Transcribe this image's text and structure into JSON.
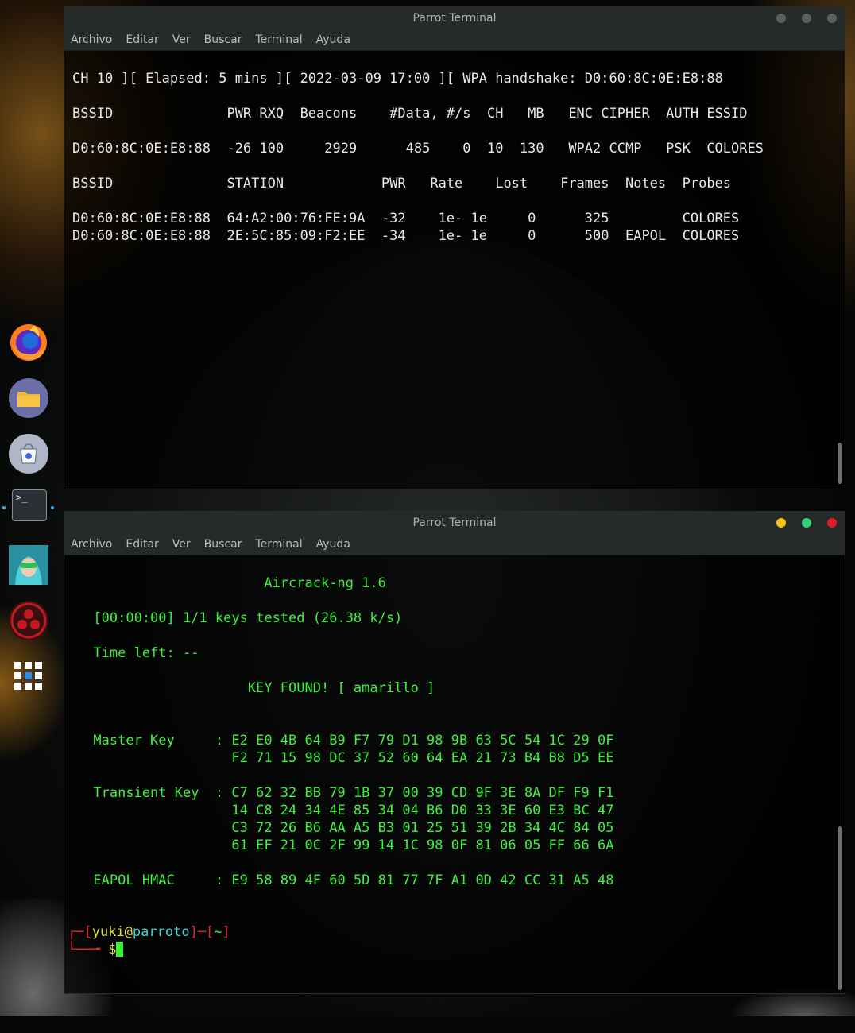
{
  "dock": {
    "items": [
      {
        "name": "firefox",
        "icon": "firefox-icon"
      },
      {
        "name": "files",
        "icon": "folder-icon"
      },
      {
        "name": "software-store",
        "icon": "store-icon"
      },
      {
        "name": "terminal",
        "icon": "terminal-icon"
      },
      {
        "name": "avatar",
        "icon": "avatar-icon"
      },
      {
        "name": "parrot",
        "icon": "parrot-icon"
      },
      {
        "name": "app-grid",
        "icon": "grid-icon"
      }
    ],
    "terminal_glyph": ">_"
  },
  "menu": [
    "Archivo",
    "Editar",
    "Ver",
    "Buscar",
    "Terminal",
    "Ayuda"
  ],
  "window_top": {
    "title": "Parrot Terminal",
    "lines": [
      "",
      "CH 10 ][ Elapsed: 5 mins ][ 2022-03-09 17:00 ][ WPA handshake: D0:60:8C:0E:E8:88",
      "",
      "BSSID              PWR RXQ  Beacons    #Data, #/s  CH   MB   ENC CIPHER  AUTH ESSID",
      "",
      "D0:60:8C:0E:E8:88  -26 100     2929      485    0  10  130   WPA2 CCMP   PSK  COLORES",
      "",
      "BSSID              STATION            PWR   Rate    Lost    Frames  Notes  Probes",
      "",
      "D0:60:8C:0E:E8:88  64:A2:00:76:FE:9A  -32    1e- 1e     0      325         COLORES",
      "D0:60:8C:0E:E8:88  2E:5C:85:09:F2:EE  -34    1e- 1e     0      500  EAPOL  COLORES"
    ]
  },
  "window_bottom": {
    "title": "Parrot Terminal",
    "lines": [
      "",
      "                           Aircrack-ng 1.6",
      "",
      "      [00:00:00] 1/1 keys tested (26.38 k/s)",
      "",
      "      Time left: --",
      "",
      "                         KEY FOUND! [ amarillo ]",
      "",
      "",
      "      Master Key     : E2 E0 4B 64 B9 F7 79 D1 98 9B 63 5C 54 1C 29 0F",
      "                       F2 71 15 98 DC 37 52 60 64 EA 21 73 B4 B8 D5 EE",
      "",
      "      Transient Key  : C7 62 32 BB 79 1B 37 00 39 CD 9F 3E 8A DF F9 F1",
      "                       14 C8 24 34 4E 85 34 04 B6 D0 33 3E 60 E3 BC 47",
      "                       C3 72 26 B6 AA A5 B3 01 25 51 39 2B 34 4C 84 05",
      "                       61 EF 21 0C 2F 99 14 1C 98 0F 81 06 05 FF 66 6A",
      "",
      "      EAPOL HMAC     : E9 58 89 4F 60 5D 81 77 7F A1 0D 42 CC 31 A5 48",
      "",
      ""
    ],
    "prompt": {
      "corner_top": "┌─[",
      "user": "yuki",
      "at": "@",
      "host": "parroto",
      "sep": "]─[",
      "dir": "~",
      "close": "]",
      "corner_bottom": "└──╼ ",
      "symbol": "$"
    }
  },
  "colors": {
    "terminal_green": "#3df03d",
    "prompt_red": "#e8262a",
    "prompt_user": "#e0e030",
    "prompt_host": "#42d1d6",
    "btn_minimize": "#f5c211",
    "btn_maximize": "#33d17a",
    "btn_close": "#e01b24",
    "btn_inactive": "#5c5f5e"
  }
}
